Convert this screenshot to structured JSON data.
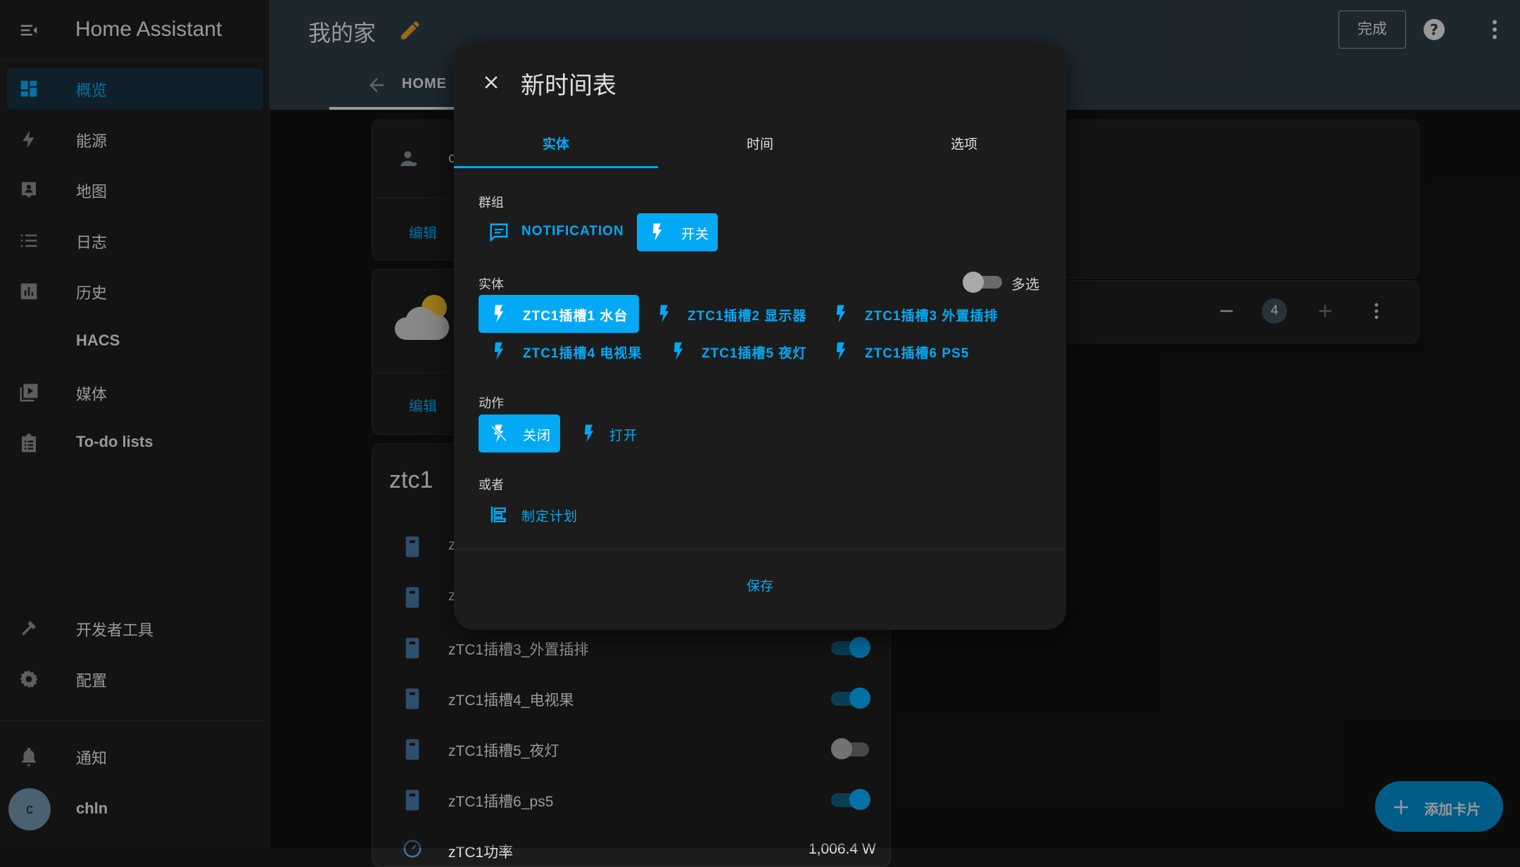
{
  "sidebar": {
    "title": "Home Assistant",
    "items": [
      {
        "label": "概览",
        "icon": "dashboard-icon"
      },
      {
        "label": "能源",
        "icon": "lightning-icon"
      },
      {
        "label": "地图",
        "icon": "map-account-icon"
      },
      {
        "label": "日志",
        "icon": "list-icon"
      },
      {
        "label": "历史",
        "icon": "chart-box-icon"
      },
      {
        "label": "HACS",
        "icon": ""
      },
      {
        "label": "媒体",
        "icon": "play-box-multiple-icon"
      },
      {
        "label": "To-do lists",
        "icon": "clipboard-list-icon"
      },
      {
        "label": "开发者工具",
        "icon": "hammer-icon"
      },
      {
        "label": "配置",
        "icon": "gear-icon"
      },
      {
        "label": "通知",
        "icon": "bell-icon"
      }
    ],
    "user": {
      "name": "chln",
      "initial": "c"
    }
  },
  "header": {
    "title": "我的家",
    "done_label": "完成",
    "view_tab": "HOME"
  },
  "cards": {
    "card1_partial": "c",
    "edit_label": "编辑",
    "counter_value": "4",
    "ztc_title": "ztc1",
    "rows": [
      {
        "label": "z",
        "state": "on"
      },
      {
        "label": "z",
        "state": "on"
      },
      {
        "label": "zTC1插槽3_外置插排",
        "state": "on"
      },
      {
        "label": "zTC1插槽4_电视果",
        "state": "on"
      },
      {
        "label": "zTC1插槽5_夜灯",
        "state": "off"
      },
      {
        "label": "zTC1插槽6_ps5",
        "state": "on"
      }
    ],
    "power": {
      "label": "zTC1功率",
      "value": "1,006.4 W"
    },
    "fab_label": "添加卡片"
  },
  "dialog": {
    "title": "新时间表",
    "tabs": [
      "实体",
      "时间",
      "选项"
    ],
    "group_label": "群组",
    "groups": [
      {
        "label": "NOTIFICATION",
        "icon": "message-text-icon",
        "selected": false
      },
      {
        "label": "开关",
        "icon": "flash-icon",
        "selected": true
      }
    ],
    "entity_label": "实体",
    "multi_label": "多选",
    "entities": [
      {
        "label": "ZTC1插槽1 水台",
        "selected": true
      },
      {
        "label": "ZTC1插槽2 显示器",
        "selected": false
      },
      {
        "label": "ZTC1插槽3 外置插排",
        "selected": false
      },
      {
        "label": "ZTC1插槽4 电视果",
        "selected": false
      },
      {
        "label": "ZTC1插槽5 夜灯",
        "selected": false
      },
      {
        "label": "ZTC1插槽6 PS5",
        "selected": false
      }
    ],
    "action_label": "动作",
    "actions": [
      {
        "label": "关闭",
        "icon": "flash-off-icon",
        "selected": true
      },
      {
        "label": "打开",
        "icon": "flash-icon",
        "selected": false
      }
    ],
    "or_label": "或者",
    "plan_label": "制定计划",
    "save_label": "保存"
  },
  "colors": {
    "accent": "#03a9f4",
    "header_bg": "#2c3a44",
    "surface": "#1c1c1c",
    "background": "#111111"
  }
}
